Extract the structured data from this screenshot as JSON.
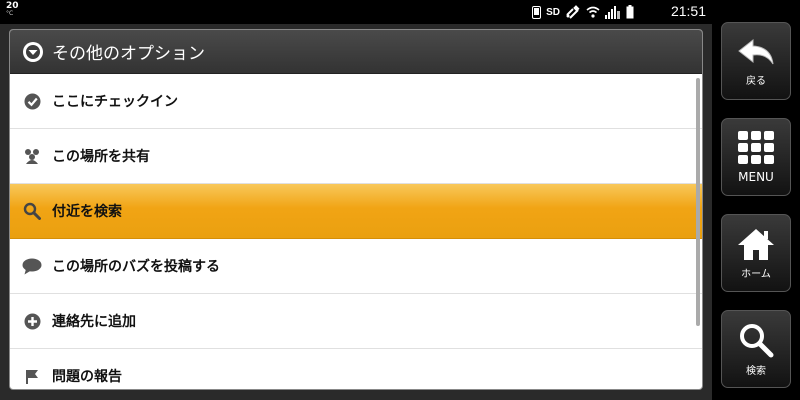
{
  "status_bar": {
    "temp": "20",
    "temp_unit": "°C",
    "sd": "SD",
    "clock": "21:51"
  },
  "dialog": {
    "title": "その他のオプション",
    "items": [
      {
        "label": "ここにチェックイン",
        "icon": "check-circle-icon",
        "selected": false
      },
      {
        "label": "この場所を共有",
        "icon": "share-people-icon",
        "selected": false
      },
      {
        "label": "付近を検索",
        "icon": "search-icon",
        "selected": true
      },
      {
        "label": "この場所のバズを投稿する",
        "icon": "speech-bubble-icon",
        "selected": false
      },
      {
        "label": "連絡先に追加",
        "icon": "plus-circle-icon",
        "selected": false
      },
      {
        "label": "問題の報告",
        "icon": "flag-icon",
        "selected": false
      }
    ]
  },
  "side_keys": {
    "back": "戻る",
    "menu": "MENU",
    "home": "ホーム",
    "search": "検索"
  },
  "colors": {
    "highlight": "#f1a414",
    "header": "#3c3c3c",
    "icon_gray": "#555555"
  }
}
